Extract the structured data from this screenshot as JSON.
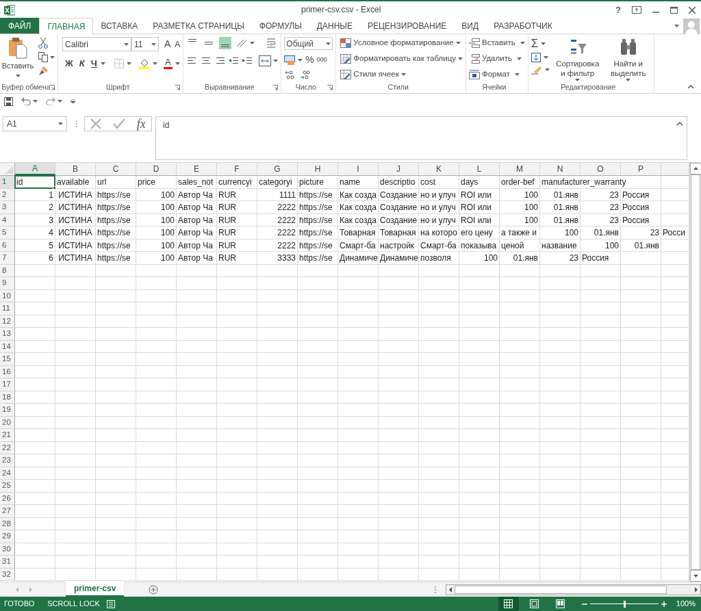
{
  "window": {
    "title": "primer-csv.csv - Excel",
    "help": "?"
  },
  "tabs": [
    {
      "label": "ФАЙЛ",
      "kind": "file",
      "selected": false
    },
    {
      "label": "ГЛАВНАЯ",
      "kind": "tab",
      "selected": true
    },
    {
      "label": "ВСТАВКА",
      "kind": "tab",
      "selected": false
    },
    {
      "label": "РАЗМЕТКА СТРАНИЦЫ",
      "kind": "tab",
      "selected": false
    },
    {
      "label": "ФОРМУЛЫ",
      "kind": "tab",
      "selected": false
    },
    {
      "label": "ДАННЫЕ",
      "kind": "tab",
      "selected": false
    },
    {
      "label": "РЕЦЕНЗИРОВАНИЕ",
      "kind": "tab",
      "selected": false
    },
    {
      "label": "ВИД",
      "kind": "tab",
      "selected": false
    },
    {
      "label": "РАЗРАБОТЧИК",
      "kind": "tab",
      "selected": false
    }
  ],
  "ribbon": {
    "clipboard": {
      "paste": "Вставить",
      "label": "Буфер обмена"
    },
    "font": {
      "name": "Calibri",
      "size": "11",
      "grow": "A",
      "shrink": "A",
      "bold": "Ж",
      "italic": "К",
      "underline": "Ч",
      "color_letter": "A",
      "label": "Шрифт"
    },
    "alignment": {
      "label": "Выравнивание"
    },
    "number": {
      "format": "Общий",
      "percent": "%",
      "thousands": "000",
      "label": "Число"
    },
    "styles": {
      "items": [
        "Условное форматирование",
        "Форматировать как таблицу",
        "Стили ячеек"
      ],
      "label": "Стили"
    },
    "cells": {
      "items": [
        "Вставить",
        "Удалить",
        "Формат"
      ],
      "label": "Ячейки"
    },
    "editing": {
      "sigma": "Σ",
      "sort": "Сортировка и фильтр",
      "find": "Найти и выделить",
      "label": "Редактирование"
    }
  },
  "formula_bar": {
    "name_box": "A1",
    "fx": "fx",
    "content": "id"
  },
  "sheet": {
    "columns": [
      {
        "label": "A",
        "selected": true
      },
      {
        "label": "B",
        "selected": false
      },
      {
        "label": "C",
        "selected": false
      },
      {
        "label": "D",
        "selected": false
      },
      {
        "label": "E",
        "selected": false
      },
      {
        "label": "F",
        "selected": false
      },
      {
        "label": "G",
        "selected": false
      },
      {
        "label": "H",
        "selected": false
      },
      {
        "label": "I",
        "selected": false
      },
      {
        "label": "J",
        "selected": false
      },
      {
        "label": "K",
        "selected": false
      },
      {
        "label": "L",
        "selected": false
      },
      {
        "label": "M",
        "selected": false
      },
      {
        "label": "N",
        "selected": false
      },
      {
        "label": "O",
        "selected": false
      },
      {
        "label": "P",
        "selected": false
      }
    ],
    "rows": [
      {
        "number": "1",
        "selected": true,
        "cells": [
          {
            "kind": "text",
            "text": "id",
            "selected": true
          },
          {
            "kind": "text",
            "text": "available"
          },
          {
            "kind": "text",
            "text": "url"
          },
          {
            "kind": "text",
            "text": "price"
          },
          {
            "kind": "text",
            "text": "sales_not"
          },
          {
            "kind": "text",
            "text": "currencyi"
          },
          {
            "kind": "text",
            "text": "categoryi"
          },
          {
            "kind": "text",
            "text": "picture"
          },
          {
            "kind": "text",
            "text": "name"
          },
          {
            "kind": "text",
            "text": "descriptio"
          },
          {
            "kind": "text",
            "text": "cost"
          },
          {
            "kind": "text",
            "text": "days"
          },
          {
            "kind": "text",
            "text": "order-bef"
          },
          {
            "kind": "text",
            "text": "manufacturer_warranty"
          }
        ]
      },
      {
        "number": "2",
        "selected": false,
        "cells": [
          {
            "kind": "number",
            "text": "1"
          },
          {
            "kind": "bool",
            "text": "ИСТИНА"
          },
          {
            "kind": "text",
            "text": "https://se"
          },
          {
            "kind": "number",
            "text": "100"
          },
          {
            "kind": "text",
            "text": "Автор Ча"
          },
          {
            "kind": "text",
            "text": "RUR"
          },
          {
            "kind": "number",
            "text": "1111"
          },
          {
            "kind": "text",
            "text": "https://se"
          },
          {
            "kind": "text",
            "text": "Как созда"
          },
          {
            "kind": "text",
            "text": "Создание"
          },
          {
            "kind": "text",
            "text": "но и улуч"
          },
          {
            "kind": "text",
            "text": "ROI или"
          },
          {
            "kind": "number",
            "text": "100"
          },
          {
            "kind": "number",
            "text": "01.янв"
          },
          {
            "kind": "number",
            "text": "23"
          },
          {
            "kind": "text",
            "text": "Россия"
          }
        ]
      },
      {
        "number": "3",
        "selected": false,
        "cells": [
          {
            "kind": "number",
            "text": "2"
          },
          {
            "kind": "bool",
            "text": "ИСТИНА"
          },
          {
            "kind": "text",
            "text": "https://se"
          },
          {
            "kind": "number",
            "text": "100"
          },
          {
            "kind": "text",
            "text": "Автор Ча"
          },
          {
            "kind": "text",
            "text": "RUR"
          },
          {
            "kind": "number",
            "text": "2222"
          },
          {
            "kind": "text",
            "text": "https://se"
          },
          {
            "kind": "text",
            "text": "Как созда"
          },
          {
            "kind": "text",
            "text": "Создание"
          },
          {
            "kind": "text",
            "text": "но и улуч"
          },
          {
            "kind": "text",
            "text": "ROI или"
          },
          {
            "kind": "number",
            "text": "100"
          },
          {
            "kind": "number",
            "text": "01.янв"
          },
          {
            "kind": "number",
            "text": "23"
          },
          {
            "kind": "text",
            "text": "Россия"
          }
        ]
      },
      {
        "number": "4",
        "selected": false,
        "cells": [
          {
            "kind": "number",
            "text": "3"
          },
          {
            "kind": "bool",
            "text": "ИСТИНА"
          },
          {
            "kind": "text",
            "text": "https://se"
          },
          {
            "kind": "number",
            "text": "100"
          },
          {
            "kind": "text",
            "text": "Автор Ча"
          },
          {
            "kind": "text",
            "text": "RUR"
          },
          {
            "kind": "number",
            "text": "2222"
          },
          {
            "kind": "text",
            "text": "https://se"
          },
          {
            "kind": "text",
            "text": "Как созда"
          },
          {
            "kind": "text",
            "text": "Создание"
          },
          {
            "kind": "text",
            "text": "но и улуч"
          },
          {
            "kind": "text",
            "text": "ROI или"
          },
          {
            "kind": "number",
            "text": "100"
          },
          {
            "kind": "number",
            "text": "01.янв"
          },
          {
            "kind": "number",
            "text": "23"
          },
          {
            "kind": "text",
            "text": "Россия"
          }
        ]
      },
      {
        "number": "5",
        "selected": false,
        "cells": [
          {
            "kind": "number",
            "text": "4"
          },
          {
            "kind": "bool",
            "text": "ИСТИНА"
          },
          {
            "kind": "text",
            "text": "https://se"
          },
          {
            "kind": "number",
            "text": "100"
          },
          {
            "kind": "text",
            "text": "Автор Ча"
          },
          {
            "kind": "text",
            "text": "RUR"
          },
          {
            "kind": "number",
            "text": "2222"
          },
          {
            "kind": "text",
            "text": "https://se"
          },
          {
            "kind": "text",
            "text": "Товарная"
          },
          {
            "kind": "text",
            "text": "Товарная"
          },
          {
            "kind": "text",
            "text": "на которо"
          },
          {
            "kind": "text",
            "text": "его цену"
          },
          {
            "kind": "text",
            "text": "а также и"
          },
          {
            "kind": "number",
            "text": "100"
          },
          {
            "kind": "number",
            "text": "01.янв"
          },
          {
            "kind": "number",
            "text": "23"
          },
          {
            "kind": "text",
            "text": "Росси"
          }
        ]
      },
      {
        "number": "6",
        "selected": false,
        "cells": [
          {
            "kind": "number",
            "text": "5"
          },
          {
            "kind": "bool",
            "text": "ИСТИНА"
          },
          {
            "kind": "text",
            "text": "https://se"
          },
          {
            "kind": "number",
            "text": "100"
          },
          {
            "kind": "text",
            "text": "Автор Ча"
          },
          {
            "kind": "text",
            "text": "RUR"
          },
          {
            "kind": "number",
            "text": "2222"
          },
          {
            "kind": "text",
            "text": "https://se"
          },
          {
            "kind": "text",
            "text": "Смарт-ба"
          },
          {
            "kind": "text",
            "text": "настройк"
          },
          {
            "kind": "text",
            "text": "Смарт-ба"
          },
          {
            "kind": "text",
            "text": "показыва"
          },
          {
            "kind": "text",
            "text": "ценой"
          },
          {
            "kind": "text",
            "text": "название"
          },
          {
            "kind": "number",
            "text": "100"
          },
          {
            "kind": "number",
            "text": "01.янв"
          }
        ]
      },
      {
        "number": "7",
        "selected": false,
        "cells": [
          {
            "kind": "number",
            "text": "6"
          },
          {
            "kind": "bool",
            "text": "ИСТИНА"
          },
          {
            "kind": "text",
            "text": "https://se"
          },
          {
            "kind": "number",
            "text": "100"
          },
          {
            "kind": "text",
            "text": "Автор Ча"
          },
          {
            "kind": "text",
            "text": "RUR"
          },
          {
            "kind": "number",
            "text": "3333"
          },
          {
            "kind": "text",
            "text": "https://se"
          },
          {
            "kind": "text",
            "text": "Динамиче"
          },
          {
            "kind": "text",
            "text": "Динамиче"
          },
          {
            "kind": "text",
            "text": "позволя"
          },
          {
            "kind": "number",
            "text": "100"
          },
          {
            "kind": "number",
            "text": "01.янв"
          },
          {
            "kind": "number",
            "text": "23"
          },
          {
            "kind": "text",
            "text": "Россия"
          }
        ]
      },
      {
        "number": "8",
        "selected": false
      },
      {
        "number": "9",
        "selected": false
      },
      {
        "number": "10",
        "selected": false
      },
      {
        "number": "11",
        "selected": false
      },
      {
        "number": "12",
        "selected": false
      },
      {
        "number": "13",
        "selected": false
      },
      {
        "number": "14",
        "selected": false
      },
      {
        "number": "15",
        "selected": false
      },
      {
        "number": "16",
        "selected": false
      },
      {
        "number": "17",
        "selected": false
      },
      {
        "number": "18",
        "selected": false
      },
      {
        "number": "19",
        "selected": false
      },
      {
        "number": "20",
        "selected": false
      },
      {
        "number": "21",
        "selected": false
      },
      {
        "number": "22",
        "selected": false
      },
      {
        "number": "23",
        "selected": false
      },
      {
        "number": "24",
        "selected": false
      },
      {
        "number": "25",
        "selected": false
      },
      {
        "number": "26",
        "selected": false
      },
      {
        "number": "27",
        "selected": false
      },
      {
        "number": "28",
        "selected": false
      },
      {
        "number": "29",
        "selected": false
      },
      {
        "number": "30",
        "selected": false
      },
      {
        "number": "31",
        "selected": false
      },
      {
        "number": "32",
        "selected": false
      }
    ]
  },
  "sheet_tabs": [
    {
      "label": "primer-csv",
      "selected": true
    }
  ],
  "status_bar": {
    "mode": "ГОТОВО",
    "scroll_lock": "SCROLL LOCK",
    "views": [
      {
        "kind": "normal",
        "selected": true
      },
      {
        "kind": "page_layout",
        "selected": false
      },
      {
        "kind": "page_break",
        "selected": false
      }
    ],
    "zoom_slider": {
      "level": 0.5
    },
    "zoom": "100%"
  }
}
